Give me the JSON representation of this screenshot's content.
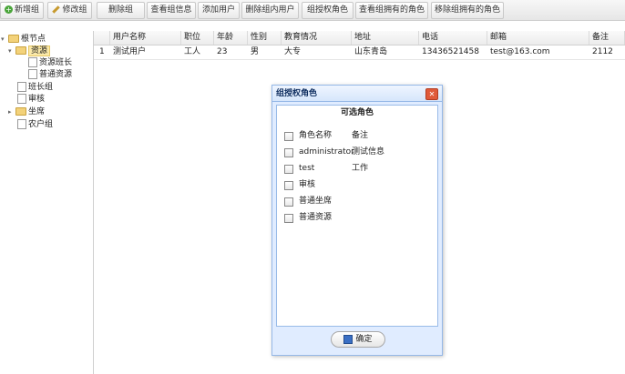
{
  "toolbar": {
    "buttons": [
      {
        "label": "新增组",
        "icon": "add-icon"
      },
      {
        "label": "修改组",
        "icon": "edit-icon"
      },
      {
        "label": "删除组"
      },
      {
        "label": "查看组信息"
      },
      {
        "label": "添加用户"
      },
      {
        "label": "删除组内用户"
      },
      {
        "label": "组授权角色"
      },
      {
        "label": "查看组拥有的角色"
      },
      {
        "label": "移除组拥有的角色"
      }
    ]
  },
  "tree": {
    "nodes": [
      {
        "label": "根节点",
        "level": 0,
        "type": "folder",
        "toggle": "▾"
      },
      {
        "label": "资源",
        "level": 1,
        "type": "folder",
        "toggle": "▾",
        "selected": true
      },
      {
        "label": "资源班长",
        "level": 2,
        "type": "file"
      },
      {
        "label": "普通资源",
        "level": 2,
        "type": "file"
      },
      {
        "label": "班长组",
        "level": 1,
        "type": "file"
      },
      {
        "label": "审核",
        "level": 1,
        "type": "file"
      },
      {
        "label": "坐席",
        "level": 1,
        "type": "folder",
        "toggle": "▸"
      },
      {
        "label": "农户组",
        "level": 1,
        "type": "file"
      }
    ]
  },
  "grid": {
    "columns": [
      "",
      "用户名称",
      "职位",
      "年龄",
      "性别",
      "教育情况",
      "地址",
      "电话",
      "邮箱",
      "备注"
    ],
    "rows": [
      [
        "1",
        "测试用户",
        "工人",
        "23",
        "男",
        "大专",
        "山东青岛",
        "13436521458",
        "test@163.com",
        "2112"
      ]
    ]
  },
  "dialog": {
    "title": "组授权角色",
    "close_glyph": "✕",
    "heading": "可选角色",
    "header_row": {
      "name": "角色名称",
      "note": "备注"
    },
    "roles": [
      {
        "name": "administrator",
        "note": "测试信息"
      },
      {
        "name": "test",
        "note": "工作"
      },
      {
        "name": "审核",
        "note": ""
      },
      {
        "name": "普通坐席",
        "note": ""
      },
      {
        "name": "普通资源",
        "note": ""
      }
    ],
    "ok_label": "确定"
  },
  "colors": {
    "accent": "#95b8e7",
    "selected": "#fbe9a8"
  }
}
